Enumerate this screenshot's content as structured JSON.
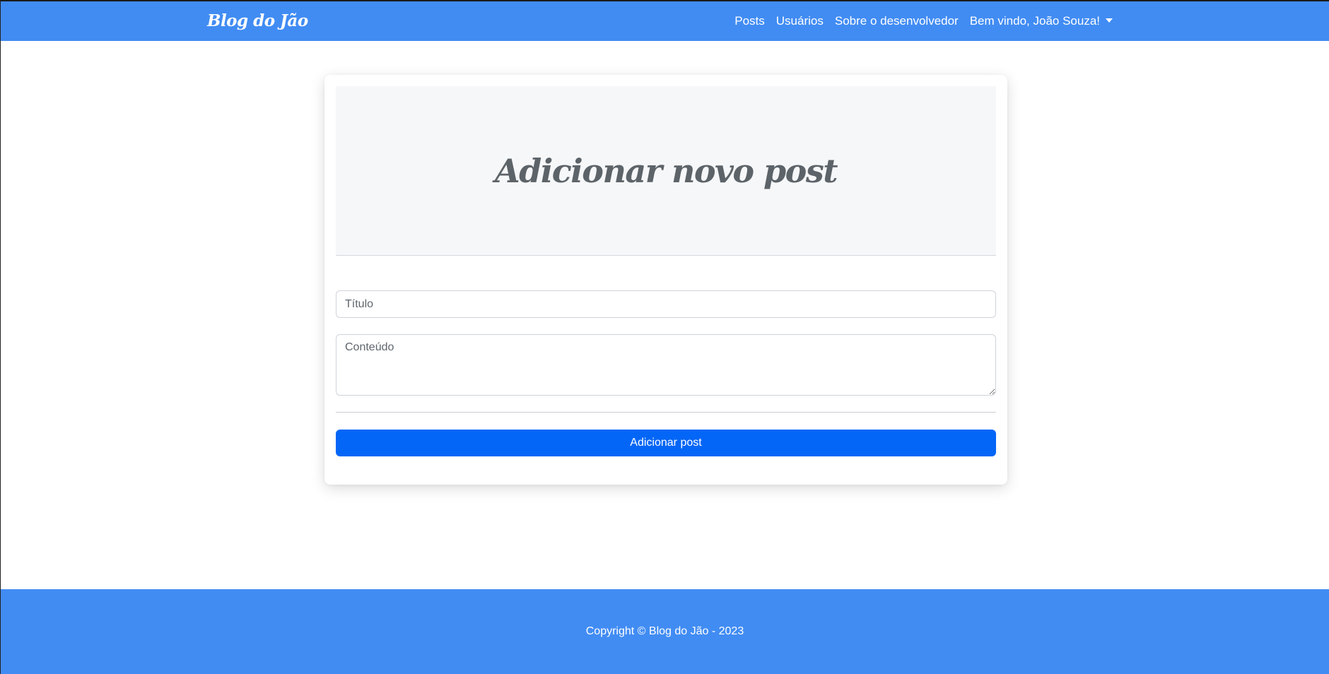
{
  "navbar": {
    "brand": "Blog do Jão",
    "links": [
      "Posts",
      "Usuários",
      "Sobre o desenvolvedor"
    ],
    "user_menu": "Bem vindo, João Souza!"
  },
  "card": {
    "title": "Adicionar novo post",
    "title_placeholder": "Título",
    "content_placeholder": "Conteúdo",
    "submit_label": "Adicionar post"
  },
  "footer": {
    "text": "Copyright © Blog do Jão - 2023"
  },
  "colors": {
    "navbar": "#418cf3",
    "button": "#0466f7",
    "header_bg": "#f6f7f9"
  }
}
